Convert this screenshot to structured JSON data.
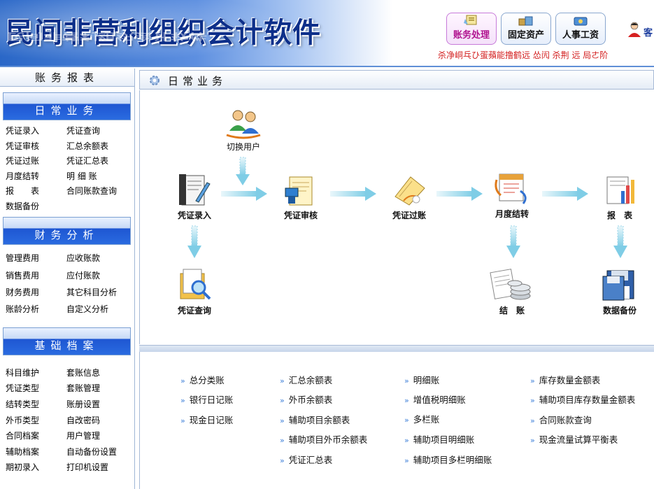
{
  "app": {
    "title": "民间非营利组织会计软件",
    "title_reflection": "民间非营利组织会计软件",
    "top_buttons": [
      {
        "label": "账务处理",
        "icon": "ledger-icon",
        "active": true
      },
      {
        "label": "固定资产",
        "icon": "assets-icon"
      },
      {
        "label": "人事工资",
        "icon": "salary-icon"
      }
    ],
    "garbled_line": "杀净峒乓ひ蛋蘋能撸鹤远  怂闶     杀荆  远       局ㄜ阶",
    "user_label": "客"
  },
  "sidebar": {
    "title": "账务报表",
    "sections": [
      {
        "title": "日常业务",
        "items": [
          "凭证录入",
          "凭证查询",
          "凭证审核",
          "汇总余额表",
          "凭证过账",
          "凭证汇总表",
          "月度结转",
          "明 细 账",
          "报　　表",
          "合同账款查询",
          "数据备份"
        ]
      },
      {
        "title": "财务分析",
        "items": [
          "管理费用",
          "应收账款",
          "销售费用",
          "应付账款",
          "财务费用",
          "其它科目分析",
          "账龄分析",
          "自定义分析"
        ]
      },
      {
        "title": "基础档案",
        "items": [
          "科目维护",
          "套账信息",
          "凭证类型",
          "套账管理",
          "结转类型",
          "账册设置",
          "外币类型",
          "自改密码",
          "合同档案",
          "用户管理",
          "辅助档案",
          "自动备份设置",
          "期初录入",
          "打印机设置"
        ]
      }
    ]
  },
  "main": {
    "tab_title": "日常业务",
    "flow": {
      "switch_user": "切换用户",
      "voucher_entry": "凭证录入",
      "voucher_review": "凭证审核",
      "voucher_posting": "凭证过账",
      "month_close": "月度结转",
      "reports": "报　表",
      "voucher_query": "凭证查询",
      "closing": "结　账",
      "backup": "数据备份"
    },
    "report_links": [
      [
        "总分类账",
        "银行日记账",
        "现金日记账"
      ],
      [
        "汇总余额表",
        "外币余额表",
        "辅助项目余额表",
        "辅助项目外币余额表",
        "凭证汇总表"
      ],
      [
        "明细账",
        "增值税明细账",
        "多栏账",
        "辅助项目明细账",
        "辅助项目多栏明细账"
      ],
      [
        "库存数量金额表",
        "辅助项目库存数量金额表",
        "合同账款查询",
        "现金流量试算平衡表"
      ]
    ]
  },
  "colors": {
    "accent_blue": "#1e56d2",
    "arrow_cyan": "#8fd3e8",
    "garbled_red": "#d32020",
    "active_button": "#b1148f"
  }
}
